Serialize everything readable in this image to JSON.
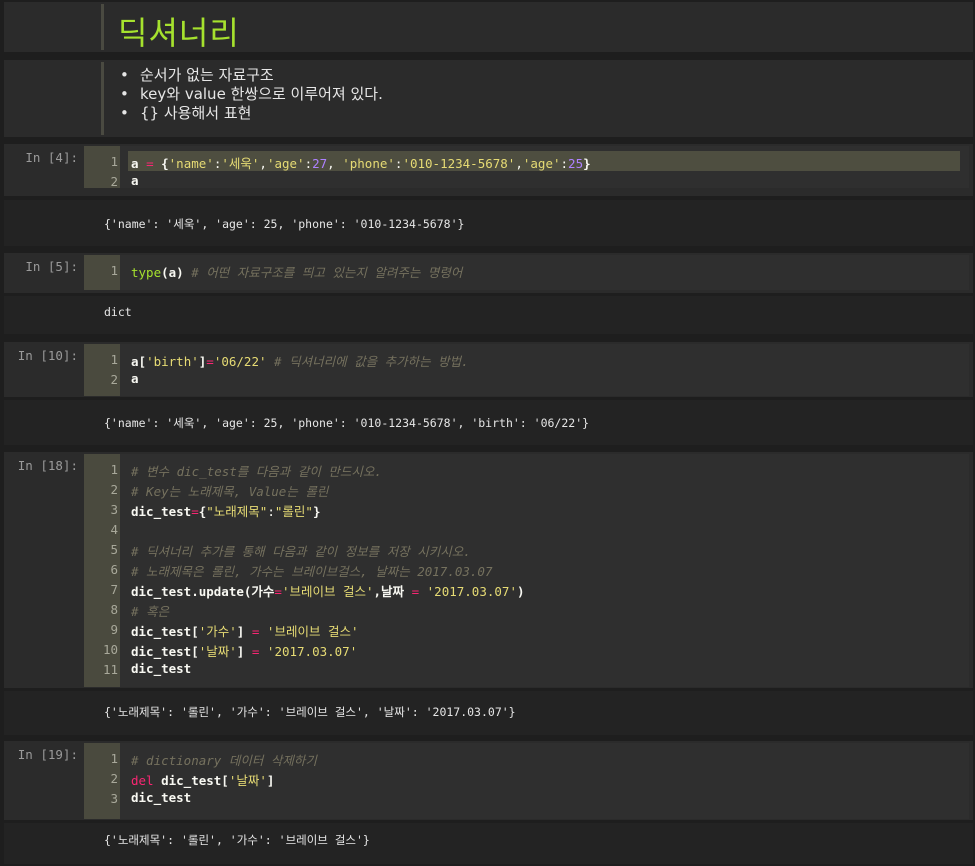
{
  "markdown": {
    "title": "딕셔너리",
    "bullets": [
      "순서가 없는 자료구조",
      "key와 value 한쌍으로 이루어져 있다.",
      "{} 사용해서 표현"
    ]
  },
  "cells": [
    {
      "prompt": "In [4]:",
      "lines": [
        [
          {
            "t": "a ",
            "c": "b"
          },
          {
            "t": "=",
            "c": "k"
          },
          {
            "t": " {",
            "c": "b"
          },
          {
            "t": "'name'",
            "c": "s"
          },
          {
            "t": ":",
            "c": ""
          },
          {
            "t": "'세욱'",
            "c": "s"
          },
          {
            "t": ",",
            "c": ""
          },
          {
            "t": "'age'",
            "c": "s"
          },
          {
            "t": ":",
            "c": ""
          },
          {
            "t": "27",
            "c": "n"
          },
          {
            "t": ", ",
            "c": ""
          },
          {
            "t": "'phone'",
            "c": "s"
          },
          {
            "t": ":",
            "c": ""
          },
          {
            "t": "'010-1234-5678'",
            "c": "s"
          },
          {
            "t": ",",
            "c": ""
          },
          {
            "t": "'age'",
            "c": "s"
          },
          {
            "t": ":",
            "c": ""
          },
          {
            "t": "25",
            "c": "n"
          },
          {
            "t": "}",
            "c": "b"
          }
        ],
        [
          {
            "t": "a",
            "c": "b"
          }
        ]
      ],
      "output": "{'name': '세욱', 'age': 25, 'phone': '010-1234-5678'}"
    },
    {
      "prompt": "In [5]:",
      "lines": [
        [
          {
            "t": "type",
            "c": "f"
          },
          {
            "t": "(a) ",
            "c": "b"
          },
          {
            "t": "# 어떤 자료구조를 띄고 있는지 알려주는 명령어",
            "c": "c"
          }
        ]
      ],
      "output": "dict"
    },
    {
      "prompt": "In [10]:",
      "lines": [
        [
          {
            "t": "a[",
            "c": "b"
          },
          {
            "t": "'birth'",
            "c": "s"
          },
          {
            "t": "]",
            "c": "b"
          },
          {
            "t": "=",
            "c": "k"
          },
          {
            "t": "'06/22'",
            "c": "s"
          },
          {
            "t": " # 딕셔너리에 값을 추가하는 방법.",
            "c": "c"
          }
        ],
        [
          {
            "t": "a",
            "c": "b"
          }
        ]
      ],
      "output": "{'name': '세욱', 'age': 25, 'phone': '010-1234-5678', 'birth': '06/22'}"
    },
    {
      "prompt": "In [18]:",
      "lines": [
        [
          {
            "t": "# 변수 dic_test를 다음과 같이 만드시오.",
            "c": "c"
          }
        ],
        [
          {
            "t": "# Key는 노래제목, Value는 롤린",
            "c": "c"
          }
        ],
        [
          {
            "t": "dic_test",
            "c": "b"
          },
          {
            "t": "=",
            "c": "k"
          },
          {
            "t": "{",
            "c": "b"
          },
          {
            "t": "\"노래제목\"",
            "c": "s"
          },
          {
            "t": ":",
            "c": ""
          },
          {
            "t": "\"롤린\"",
            "c": "s"
          },
          {
            "t": "}",
            "c": "b"
          }
        ],
        [],
        [
          {
            "t": "# 딕셔너리 추가를 통해 다음과 같이 정보를 저장 시키시오.",
            "c": "c"
          }
        ],
        [
          {
            "t": "# 노래제목은 롤린, 가수는 브레이브걸스, 날짜는 2017.03.07",
            "c": "c"
          }
        ],
        [
          {
            "t": "dic_test.update(가수",
            "c": "b"
          },
          {
            "t": "=",
            "c": "k"
          },
          {
            "t": "'브레이브 걸스'",
            "c": "s"
          },
          {
            "t": ",날짜 ",
            "c": "b"
          },
          {
            "t": "=",
            "c": "k"
          },
          {
            "t": " ",
            "c": ""
          },
          {
            "t": "'2017.03.07'",
            "c": "s"
          },
          {
            "t": ")",
            "c": "b"
          }
        ],
        [
          {
            "t": "# 혹은",
            "c": "c"
          }
        ],
        [
          {
            "t": "dic_test[",
            "c": "b"
          },
          {
            "t": "'가수'",
            "c": "s"
          },
          {
            "t": "] ",
            "c": "b"
          },
          {
            "t": "=",
            "c": "k"
          },
          {
            "t": " ",
            "c": ""
          },
          {
            "t": "'브레이브 걸스'",
            "c": "s"
          }
        ],
        [
          {
            "t": "dic_test[",
            "c": "b"
          },
          {
            "t": "'날짜'",
            "c": "s"
          },
          {
            "t": "] ",
            "c": "b"
          },
          {
            "t": "=",
            "c": "k"
          },
          {
            "t": " ",
            "c": ""
          },
          {
            "t": "'2017.03.07'",
            "c": "s"
          }
        ],
        [
          {
            "t": "dic_test",
            "c": "b"
          }
        ]
      ],
      "output": "{'노래제목': '롤린', '가수': '브레이브 걸스', '날짜': '2017.03.07'}"
    },
    {
      "prompt": "In [19]:",
      "lines": [
        [
          {
            "t": "# dictionary 데이터 삭제하기",
            "c": "c"
          }
        ],
        [
          {
            "t": "del",
            "c": "k"
          },
          {
            "t": " dic_test[",
            "c": "b"
          },
          {
            "t": "'날짜'",
            "c": "s"
          },
          {
            "t": "]",
            "c": "b"
          }
        ],
        [
          {
            "t": "dic_test",
            "c": "b"
          }
        ]
      ],
      "output": "{'노래제목': '롤린', '가수': '브레이브 걸스'}"
    }
  ]
}
